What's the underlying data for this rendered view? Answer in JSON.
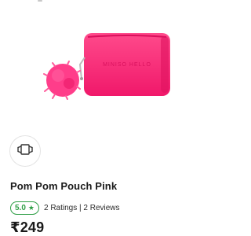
{
  "product": {
    "image_icon": "pink-pouch-with-pom-pom",
    "brand_embossed": "MINISO HELLO",
    "title": "Pom Pom Pouch Pink",
    "rating": {
      "score": "5.0",
      "star_icon": "★",
      "text": "2 Ratings | 2 Reviews",
      "color": "#2e9e45"
    },
    "price": "₹249"
  },
  "controls": {
    "ar_view_icon": "ar-view-icon"
  },
  "colors": {
    "pouch": "#ff2d78",
    "pompom": "#ff3d8a",
    "text": "#1a1a1a"
  }
}
